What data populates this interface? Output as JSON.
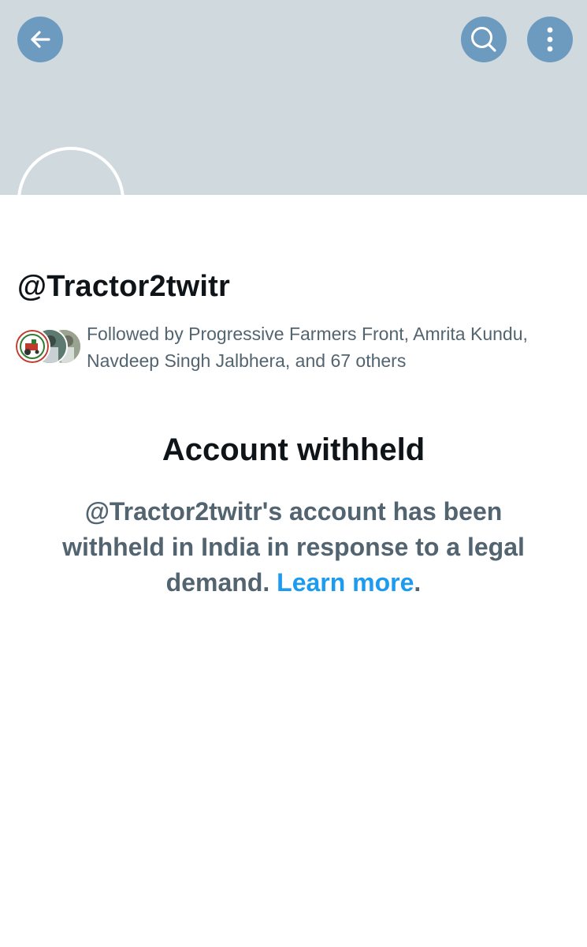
{
  "header": {
    "back_icon": "arrow-left-icon",
    "search_icon": "search-icon",
    "more_icon": "more-vertical-icon",
    "banner_color": "#cfd9de",
    "button_color": "#6d9bc0"
  },
  "profile": {
    "handle": "@Tractor2twitr",
    "followed_by": "Followed by Progressive Farmers Front, Amrita Kundu, Navdeep Singh Jalbhera, and 67 others"
  },
  "notice": {
    "title": "Account withheld",
    "message": "@Tractor2twitr's account has been withheld in India in response to a legal demand.",
    "link_label": "Learn more",
    "trailing": ".",
    "link_color": "#1d9bf0"
  }
}
